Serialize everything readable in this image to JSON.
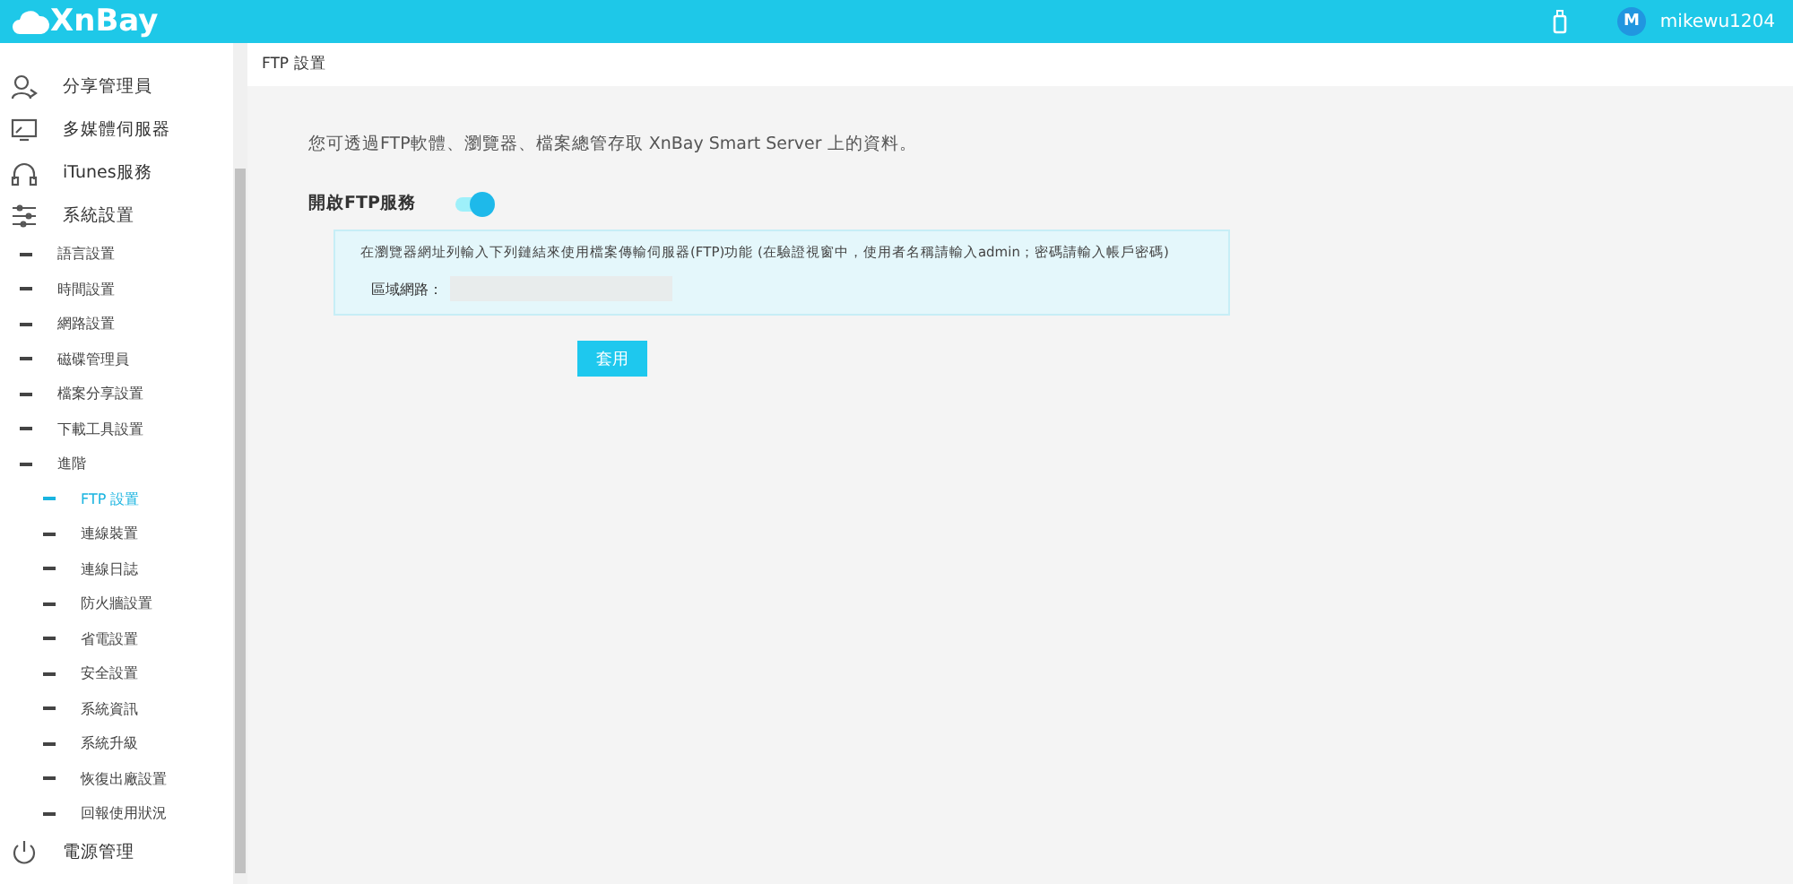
{
  "header": {
    "brand": "XnBay",
    "username": "mikewu1204",
    "avatar_initial": "M"
  },
  "sidebar": {
    "items": [
      {
        "label": "分享管理員",
        "selected": false
      },
      {
        "label": "多媒體伺服器",
        "selected": false
      },
      {
        "label": "iTunes服務",
        "selected": false
      },
      {
        "label": "系統設置",
        "selected": false,
        "children": [
          {
            "label": "語言設置",
            "selected": false
          },
          {
            "label": "時間設置",
            "selected": false
          },
          {
            "label": "網路設置",
            "selected": false
          },
          {
            "label": "磁碟管理員",
            "selected": false
          },
          {
            "label": "檔案分享設置",
            "selected": false
          },
          {
            "label": "下載工具設置",
            "selected": false
          },
          {
            "label": "進階",
            "selected": false,
            "children": [
              {
                "label": "FTP 設置",
                "selected": true
              },
              {
                "label": "連線裝置",
                "selected": false
              },
              {
                "label": "連線日誌",
                "selected": false
              },
              {
                "label": "防火牆設置",
                "selected": false
              },
              {
                "label": "省電設置",
                "selected": false
              },
              {
                "label": "安全設置",
                "selected": false
              },
              {
                "label": "系統資訊",
                "selected": false
              },
              {
                "label": "系統升級",
                "selected": false
              },
              {
                "label": "恢復出廠設置",
                "selected": false
              },
              {
                "label": "回報使用狀況",
                "selected": false
              }
            ]
          }
        ]
      },
      {
        "label": "電源管理",
        "selected": false
      }
    ]
  },
  "breadcrumb": "FTP 設置",
  "content": {
    "description": "您可透過FTP軟體、瀏覽器、檔案總管存取 XnBay Smart Server 上的資料。",
    "toggle": {
      "label": "開啟FTP服務",
      "on": true
    },
    "info": {
      "text": "在瀏覽器網址列輸入下列鏈結來使用檔案傳輸伺服器(FTP)功能 (在驗證視窗中，使用者名稱請輸入admin；密碼請輸入帳戶密碼)",
      "field_label": "區域網路："
    },
    "apply_button": "套用"
  }
}
